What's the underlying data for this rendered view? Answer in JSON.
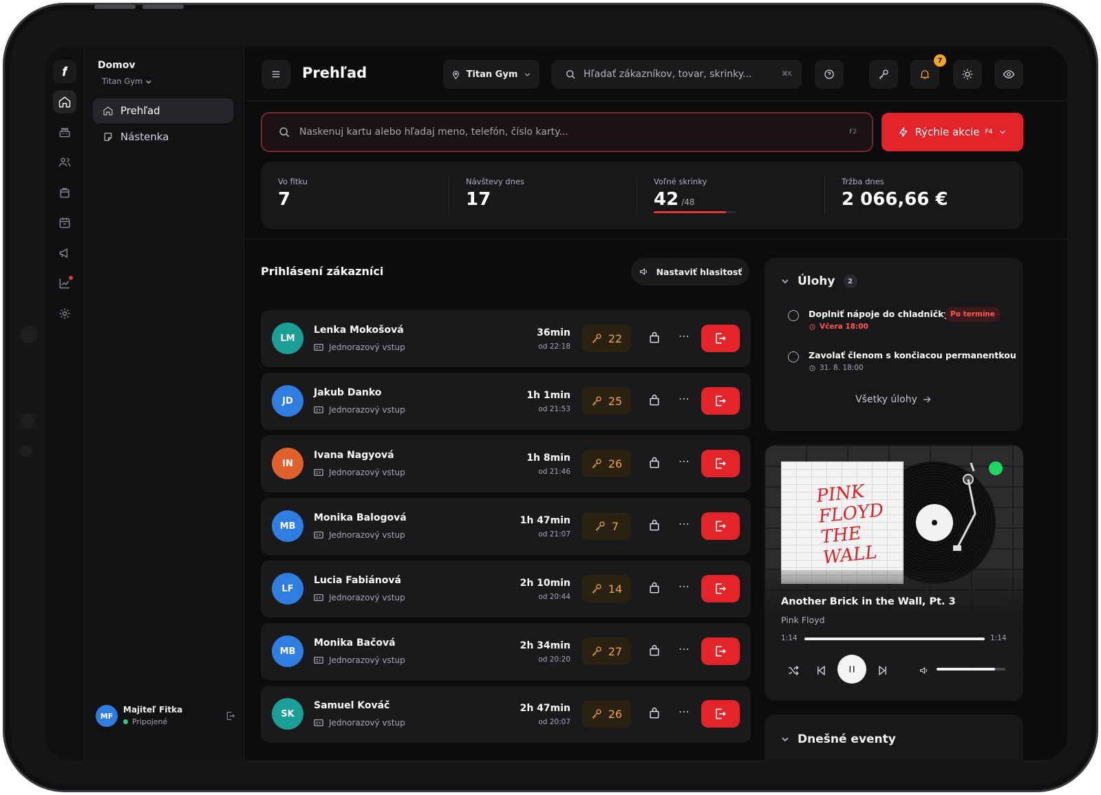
{
  "app": {
    "logo": "𝒇"
  },
  "nav": {
    "title": "Domov",
    "gym_selector": "Titan Gym",
    "items": [
      {
        "label": "Prehľad",
        "active": true
      },
      {
        "label": "Nástenka",
        "active": false
      }
    ],
    "user": {
      "initials": "MF",
      "name": "Majiteľ Fitka",
      "status": "Pripojené"
    }
  },
  "topbar": {
    "title": "Prehľad",
    "gym": "Titan Gym",
    "search_placeholder": "Hľadať zákazníkov, tovar, skrinky...",
    "search_kbd": "⌘K",
    "notification_count": "7"
  },
  "scan": {
    "placeholder": "Naskenuj kartu alebo hľadaj meno, telefón, číslo karty...",
    "kbd": "F2"
  },
  "quick_actions": {
    "label": "Rýchle akcie",
    "kbd": "F4"
  },
  "stats": [
    {
      "label": "Vo fitku",
      "value": "7"
    },
    {
      "label": "Návštevy dnes",
      "value": "17"
    },
    {
      "label": "Voľné skrinky",
      "value": "42",
      "total": "/48",
      "fraction": 0.875
    },
    {
      "label": "Tržba dnes",
      "value": "2 066,66 €"
    }
  ],
  "checked_in": {
    "title": "Prihlásení zákazníci",
    "volume_button": "Nastaviť hlasitosť",
    "customers": [
      {
        "initials": "LM",
        "name": "Lenka Mokošová",
        "type": "Jednorazový vstup",
        "duration": "36min",
        "since": "od 22:18",
        "locker": "22",
        "color": "#1a9e96"
      },
      {
        "initials": "JD",
        "name": "Jakub Danko",
        "type": "Jednorazový vstup",
        "duration": "1h 1min",
        "since": "od 21:53",
        "locker": "25",
        "color": "#2f7de1"
      },
      {
        "initials": "IN",
        "name": "Ivana Nagyová",
        "type": "Jednorazový vstup",
        "duration": "1h 8min",
        "since": "od 21:46",
        "locker": "26",
        "color": "#e0612b"
      },
      {
        "initials": "MB",
        "name": "Monika Balogová",
        "type": "Jednorazový vstup",
        "duration": "1h 47min",
        "since": "od 21:07",
        "locker": "7",
        "color": "#2f7de1"
      },
      {
        "initials": "LF",
        "name": "Lucia Fabiánová",
        "type": "Jednorazový vstup",
        "duration": "2h 10min",
        "since": "od 20:44",
        "locker": "14",
        "color": "#2f7de1"
      },
      {
        "initials": "MB",
        "name": "Monika Bačová",
        "type": "Jednorazový vstup",
        "duration": "2h 34min",
        "since": "od 20:20",
        "locker": "27",
        "color": "#2f7de1"
      },
      {
        "initials": "SK",
        "name": "Samuel Kováč",
        "type": "Jednorazový vstup",
        "duration": "2h 47min",
        "since": "od 20:07",
        "locker": "26",
        "color": "#1a9e96"
      }
    ]
  },
  "tasks": {
    "title": "Úlohy",
    "count": "2",
    "items": [
      {
        "text": "Doplniť nápoje do chladničky",
        "date": "Včera 18:00",
        "late": true,
        "badge": "Po termíne"
      },
      {
        "text": "Zavolať členom s končiacou permanentkou",
        "date": "31. 8. 18:00",
        "late": false,
        "badge": ""
      }
    ],
    "all_link": "Všetky úlohy"
  },
  "player": {
    "album_art_text": "PINK FLOYD THE WALL",
    "song": "Another Brick in the Wall, Pt. 3",
    "artist": "Pink Floyd",
    "elapsed": "1:14",
    "total": "1:14",
    "progress": 1.0,
    "volume": 0.85
  },
  "events": {
    "title": "Dnešné eventy"
  }
}
